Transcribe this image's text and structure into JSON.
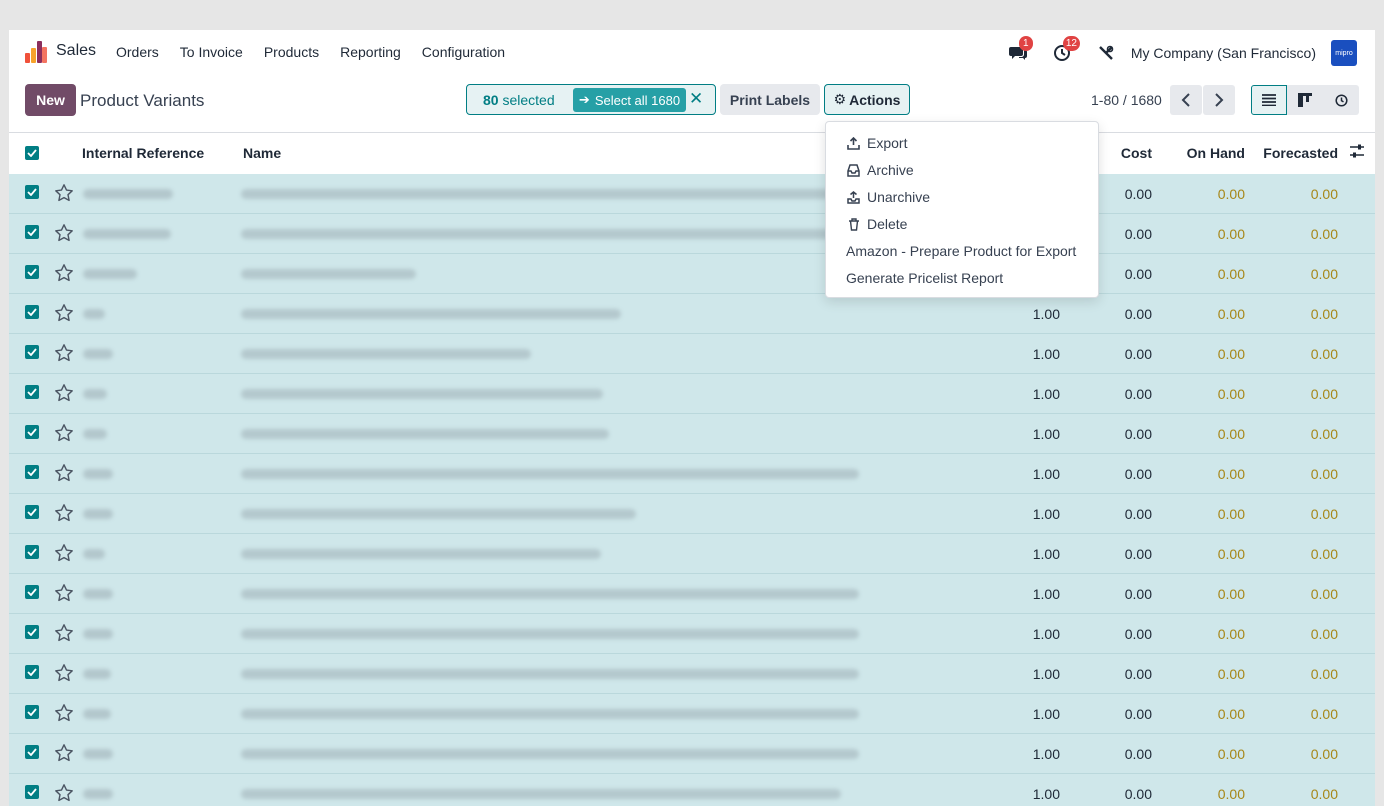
{
  "topnav": {
    "app_name": "Sales",
    "menu": [
      "Orders",
      "To Invoice",
      "Products",
      "Reporting",
      "Configuration"
    ],
    "messages_badge": "1",
    "activities_badge": "12",
    "company": "My Company (San Francisco)",
    "avatar_text": "mipro"
  },
  "control": {
    "new_label": "New",
    "title": "Product Variants",
    "selected_count": "80",
    "selected_text": "selected",
    "select_all_label": "Select all 1680",
    "print_labels": "Print Labels",
    "actions_label": "Actions",
    "pager_value": "1-80 / 1680"
  },
  "table": {
    "headers": {
      "internal_reference": "Internal Reference",
      "name": "Name",
      "cost": "Cost",
      "on_hand": "On Hand",
      "forecasted": "Forecasted"
    },
    "rows": [
      {
        "qty": "",
        "cost": "0.00",
        "on_hand": "0.00",
        "forecasted": "0.00"
      },
      {
        "qty": "",
        "cost": "0.00",
        "on_hand": "0.00",
        "forecasted": "0.00"
      },
      {
        "qty": "",
        "cost": "0.00",
        "on_hand": "0.00",
        "forecasted": "0.00"
      },
      {
        "qty": "1.00",
        "cost": "0.00",
        "on_hand": "0.00",
        "forecasted": "0.00"
      },
      {
        "qty": "1.00",
        "cost": "0.00",
        "on_hand": "0.00",
        "forecasted": "0.00"
      },
      {
        "qty": "1.00",
        "cost": "0.00",
        "on_hand": "0.00",
        "forecasted": "0.00"
      },
      {
        "qty": "1.00",
        "cost": "0.00",
        "on_hand": "0.00",
        "forecasted": "0.00"
      },
      {
        "qty": "1.00",
        "cost": "0.00",
        "on_hand": "0.00",
        "forecasted": "0.00"
      },
      {
        "qty": "1.00",
        "cost": "0.00",
        "on_hand": "0.00",
        "forecasted": "0.00"
      },
      {
        "qty": "1.00",
        "cost": "0.00",
        "on_hand": "0.00",
        "forecasted": "0.00"
      },
      {
        "qty": "1.00",
        "cost": "0.00",
        "on_hand": "0.00",
        "forecasted": "0.00"
      },
      {
        "qty": "1.00",
        "cost": "0.00",
        "on_hand": "0.00",
        "forecasted": "0.00"
      },
      {
        "qty": "1.00",
        "cost": "0.00",
        "on_hand": "0.00",
        "forecasted": "0.00"
      },
      {
        "qty": "1.00",
        "cost": "0.00",
        "on_hand": "0.00",
        "forecasted": "0.00"
      },
      {
        "qty": "1.00",
        "cost": "0.00",
        "on_hand": "0.00",
        "forecasted": "0.00"
      },
      {
        "qty": "1.00",
        "cost": "0.00",
        "on_hand": "0.00",
        "forecasted": "0.00"
      }
    ]
  },
  "actions_menu": {
    "items": [
      {
        "label": "Export",
        "icon": "upload-icon"
      },
      {
        "label": "Archive",
        "icon": "inbox-icon"
      },
      {
        "label": "Unarchive",
        "icon": "unarchive-icon"
      },
      {
        "label": "Delete",
        "icon": "trash-icon"
      },
      {
        "label": "Amazon - Prepare Product for Export",
        "icon": ""
      },
      {
        "label": "Generate Pricelist Report",
        "icon": ""
      }
    ]
  },
  "colors": {
    "brand": "#714b67",
    "accent": "#017e84",
    "row_selected": "#cfe7ea",
    "forecast_text": "#a78718",
    "badge": "#e04343"
  }
}
